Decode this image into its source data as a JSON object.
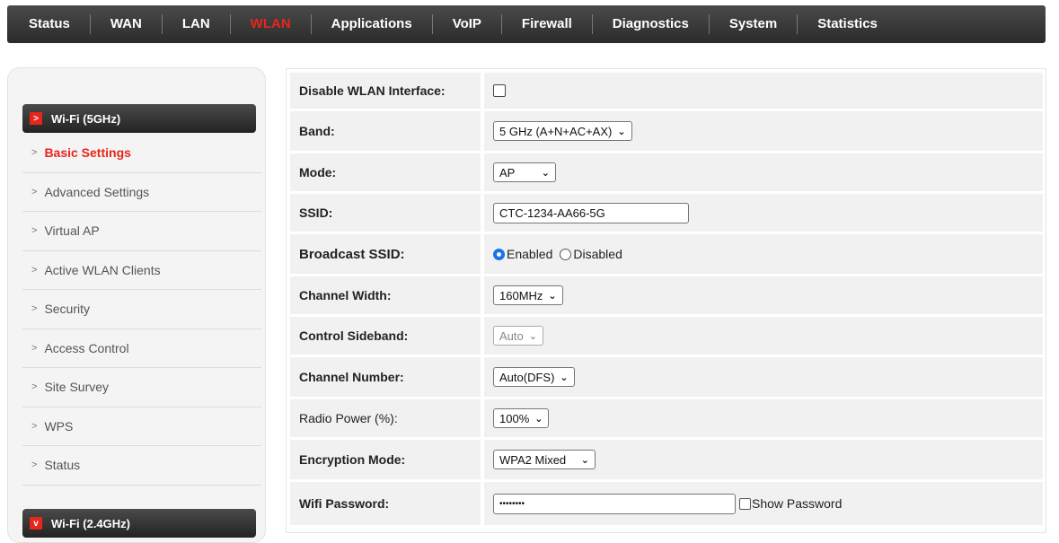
{
  "nav": {
    "items": [
      "Status",
      "WAN",
      "LAN",
      "WLAN",
      "Applications",
      "VoIP",
      "Firewall",
      "Diagnostics",
      "System",
      "Statistics"
    ],
    "active": "WLAN",
    "active_color": "#e8251c"
  },
  "sidebar": {
    "group_5g": "Wi-Fi (5GHz)",
    "group_24g": "Wi-Fi (2.4GHz)",
    "items": [
      {
        "label": "Basic Settings"
      },
      {
        "label": "Advanced Settings"
      },
      {
        "label": "Virtual AP"
      },
      {
        "label": "Active WLAN Clients"
      },
      {
        "label": "Security"
      },
      {
        "label": "Access Control"
      },
      {
        "label": "Site Survey"
      },
      {
        "label": "WPS"
      },
      {
        "label": "Status"
      }
    ]
  },
  "form": {
    "disable_wlan_label": "Disable WLAN Interface:",
    "band_label": "Band:",
    "band_value": "5 GHz (A+N+AC+AX)",
    "mode_label": "Mode:",
    "mode_value": "AP",
    "ssid_label": "SSID:",
    "ssid_value": "CTC-1234-AA66-5G",
    "broadcast_label": "Broadcast SSID:",
    "broadcast_enabled": "Enabled",
    "broadcast_disabled": "Disabled",
    "channel_width_label": "Channel Width:",
    "channel_width_value": "160MHz",
    "sideband_label": "Control Sideband:",
    "sideband_value": "Auto",
    "channel_number_label": "Channel Number:",
    "channel_number_value": "Auto(DFS)",
    "radio_power_label": "Radio Power (%):",
    "radio_power_value": "100%",
    "encryption_label": "Encryption Mode:",
    "encryption_value": "WPA2 Mixed",
    "password_label": "Wifi Password:",
    "password_value": "••••••••",
    "show_password_label": "Show Password"
  }
}
